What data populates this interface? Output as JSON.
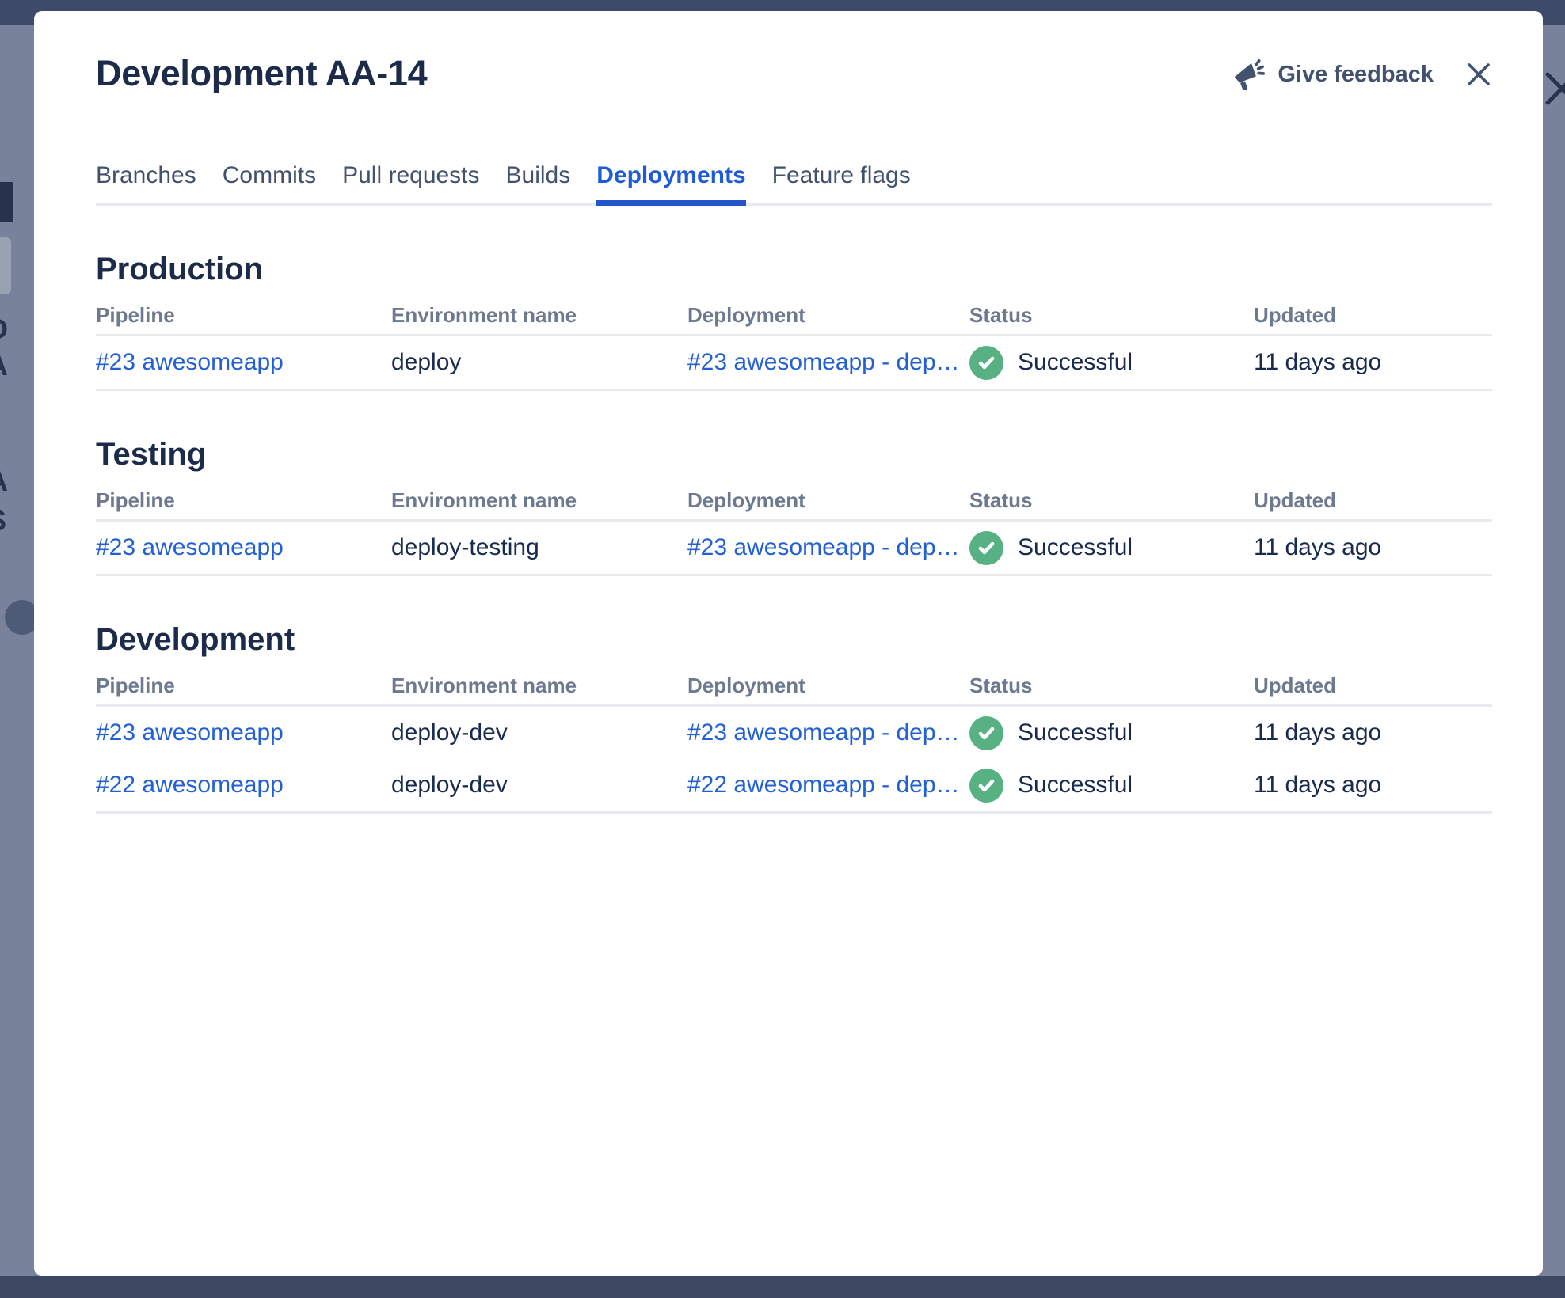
{
  "modal": {
    "title": "Development AA-14",
    "feedback_label": "Give feedback"
  },
  "tabs": [
    {
      "label": "Branches",
      "active": false
    },
    {
      "label": "Commits",
      "active": false
    },
    {
      "label": "Pull requests",
      "active": false
    },
    {
      "label": "Builds",
      "active": false
    },
    {
      "label": "Deployments",
      "active": true
    },
    {
      "label": "Feature flags",
      "active": false
    }
  ],
  "columns": [
    "Pipeline",
    "Environment name",
    "Deployment",
    "Status",
    "Updated"
  ],
  "sections": [
    {
      "heading": "Production",
      "rows": [
        {
          "pipeline": "#23 awesomeapp",
          "environment": "deploy",
          "deployment": "#23 awesomeapp - dep…",
          "status": "Successful",
          "updated": "11 days ago"
        }
      ]
    },
    {
      "heading": "Testing",
      "rows": [
        {
          "pipeline": "#23 awesomeapp",
          "environment": "deploy-testing",
          "deployment": "#23 awesomeapp - dep…",
          "status": "Successful",
          "updated": "11 days ago"
        }
      ]
    },
    {
      "heading": "Development",
      "rows": [
        {
          "pipeline": "#23 awesomeapp",
          "environment": "deploy-dev",
          "deployment": "#23 awesomeapp - dep…",
          "status": "Successful",
          "updated": "11 days ago"
        },
        {
          "pipeline": "#22 awesomeapp",
          "environment": "deploy-dev",
          "deployment": "#22 awesomeapp - dep…",
          "status": "Successful",
          "updated": "11 days ago"
        }
      ]
    }
  ],
  "icons": {
    "feedback": "megaphone-icon",
    "close": "close-icon",
    "status_success": "check-circle-icon"
  },
  "colors": {
    "link_blue": "#2360D6",
    "active_tab_blue": "#1D5CD6",
    "tab_underline_blue": "#2257CC",
    "success_green": "#57B183",
    "title_navy": "#1C2B4A",
    "header_gray": "#6C798F",
    "divider_gray": "#E8EAEE",
    "backdrop_gray_blue": "#78829B",
    "backdrop_navy_band": "#3C4862"
  }
}
